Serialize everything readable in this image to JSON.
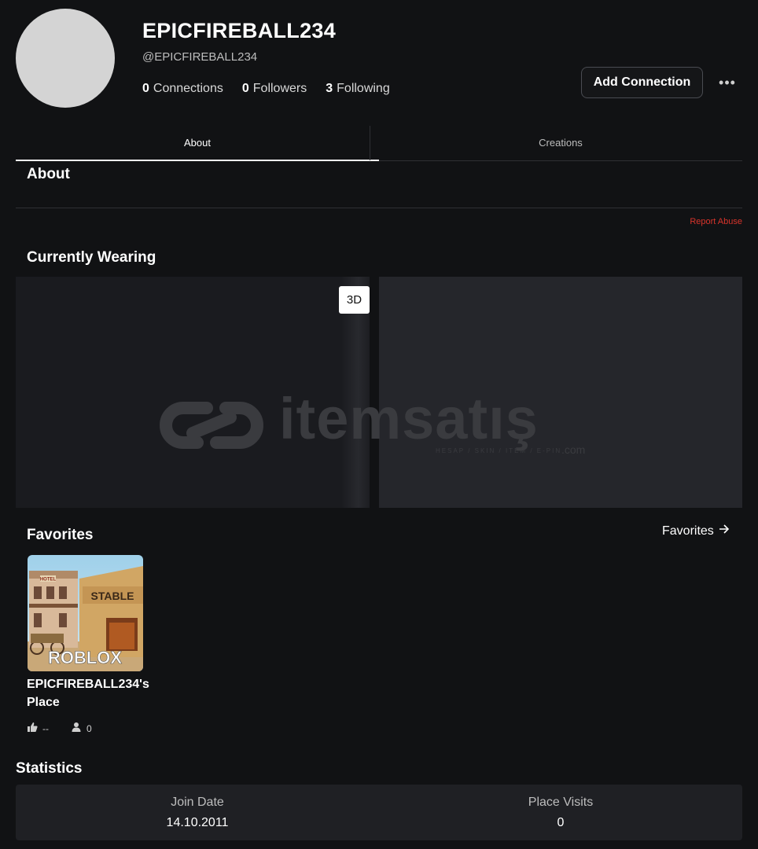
{
  "profile": {
    "display_name": "EPICFIREBALL234",
    "username": "@EPICFIREBALL234",
    "connections_count": "0",
    "connections_label": "Connections",
    "followers_count": "0",
    "followers_label": "Followers",
    "following_count": "3",
    "following_label": "Following",
    "add_connection_label": "Add Connection",
    "more_icon": "more-horizontal-icon"
  },
  "tabs": [
    {
      "label": "About",
      "active": true
    },
    {
      "label": "Creations",
      "active": false
    }
  ],
  "about": {
    "title": "About",
    "report_label": "Report Abuse"
  },
  "wearing": {
    "title": "Currently Wearing",
    "toggle_3d_label": "3D"
  },
  "watermark": {
    "text": "itemsatış",
    "subtext": "HESAP / SKIN / ITEM / E-PIN",
    "domain": ".com"
  },
  "favorites": {
    "title": "Favorites",
    "link_label": "Favorites",
    "items": [
      {
        "name": "EPICFIREBALL234's Place",
        "thumb_text": "ROBLOX",
        "sign_stable": "STABLE",
        "sign_hotel": "HOTEL",
        "likes": "--",
        "players": "0"
      }
    ]
  },
  "statistics": {
    "title": "Statistics",
    "items": [
      {
        "label": "Join Date",
        "value": "14.10.2011"
      },
      {
        "label": "Place Visits",
        "value": "0"
      }
    ]
  },
  "colors": {
    "background": "#111214",
    "report": "#d9342b",
    "panel": "#1f2024"
  }
}
